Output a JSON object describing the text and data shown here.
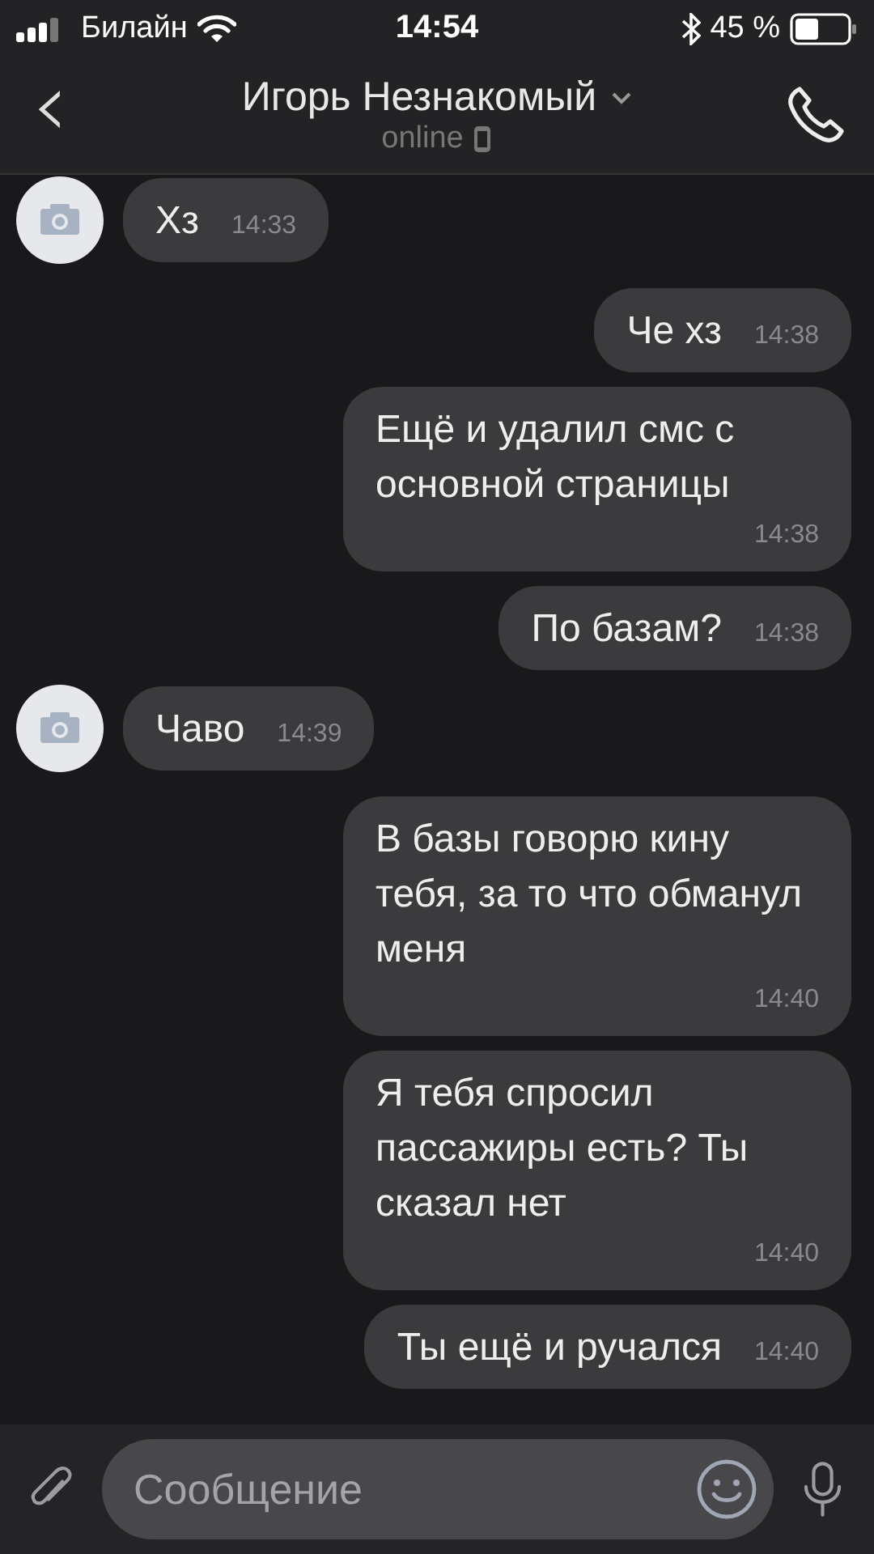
{
  "status_bar": {
    "carrier": "Билайн",
    "time": "14:54",
    "battery": "45 %"
  },
  "header": {
    "back": "‹",
    "name": "Игорь Незнакомый",
    "status": "online"
  },
  "messages": [
    {
      "kind": "incoming",
      "text": "Хз",
      "time": "14:33"
    },
    {
      "kind": "outgoing",
      "text": "Че хз",
      "time": "14:38"
    },
    {
      "kind": "outgoing",
      "text": "Ещё и удалил смс с основной страницы",
      "time": "14:38"
    },
    {
      "kind": "outgoing",
      "text": "По базам?",
      "time": "14:38"
    },
    {
      "kind": "incoming",
      "text": "Чаво",
      "time": "14:39"
    },
    {
      "kind": "outgoing",
      "text": "В базы говорю кину тебя, за то что обманул меня",
      "time": "14:40"
    },
    {
      "kind": "outgoing",
      "text": "Я тебя спросил пассажиры есть? Ты сказал нет",
      "time": "14:40"
    },
    {
      "kind": "outgoing",
      "text": "Ты ещё и ручался",
      "time": "14:40"
    }
  ],
  "composer": {
    "placeholder": "Сообщение"
  }
}
